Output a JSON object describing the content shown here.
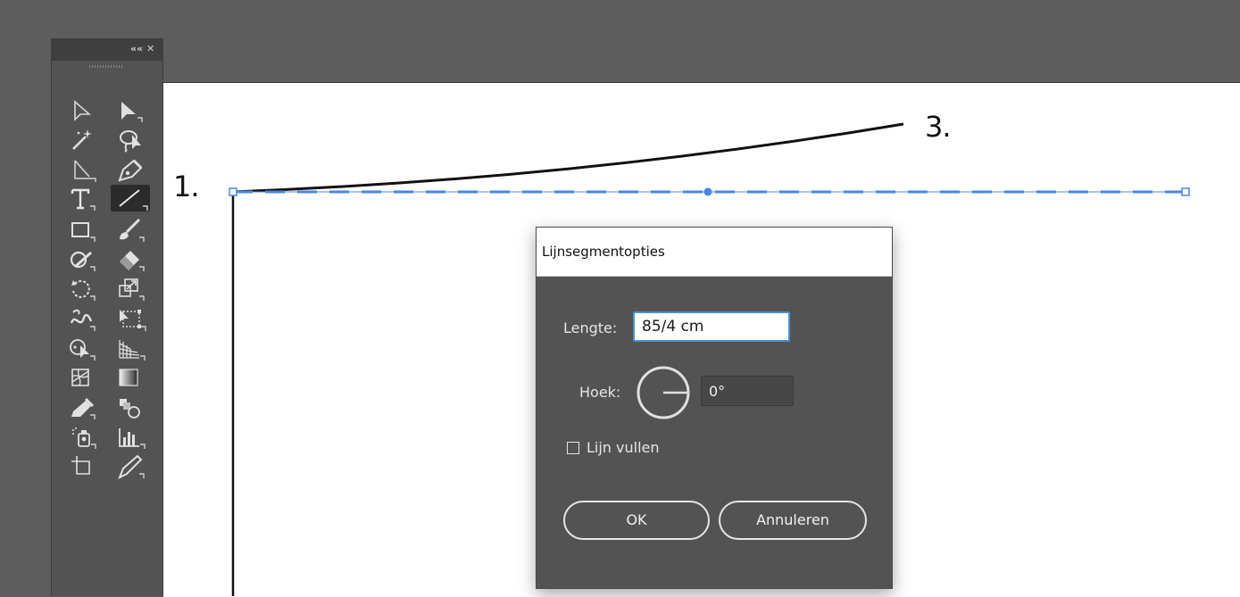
{
  "annotations": {
    "point1": "1.",
    "point3": "3."
  },
  "tools_panel": {
    "collapse_glyph": "««",
    "close_glyph": "✕",
    "tools": [
      {
        "name": "selection-tool",
        "icon": "selection-arrow-outline"
      },
      {
        "name": "direct-selection-tool",
        "icon": "direct-selection-arrow"
      },
      {
        "name": "magic-wand-tool",
        "icon": "magic-wand"
      },
      {
        "name": "lasso-tool",
        "icon": "lasso"
      },
      {
        "name": "anchor-direct-tool",
        "icon": "corner-arrow"
      },
      {
        "name": "pen-tool",
        "icon": "pen-nib"
      },
      {
        "name": "type-tool",
        "icon": "type-T"
      },
      {
        "name": "line-segment-tool",
        "icon": "line-segment",
        "active": true
      },
      {
        "name": "rectangle-tool",
        "icon": "rectangle"
      },
      {
        "name": "paintbrush-tool",
        "icon": "paintbrush"
      },
      {
        "name": "shaper-tool",
        "icon": "shaper"
      },
      {
        "name": "eraser-tool",
        "icon": "eraser"
      },
      {
        "name": "rotate-tool",
        "icon": "rotate"
      },
      {
        "name": "scale-tool",
        "icon": "scale"
      },
      {
        "name": "warp-tool",
        "icon": "warp"
      },
      {
        "name": "free-transform-tool",
        "icon": "free-transform"
      },
      {
        "name": "shape-builder-tool",
        "icon": "shape-builder"
      },
      {
        "name": "perspective-grid-tool",
        "icon": "perspective-grid"
      },
      {
        "name": "mesh-tool",
        "icon": "mesh"
      },
      {
        "name": "gradient-tool",
        "icon": "gradient"
      },
      {
        "name": "eyedropper-tool",
        "icon": "eyedropper"
      },
      {
        "name": "blend-tool",
        "icon": "blend"
      },
      {
        "name": "symbol-sprayer-tool",
        "icon": "symbol-sprayer"
      },
      {
        "name": "column-graph-tool",
        "icon": "column-graph"
      },
      {
        "name": "artboard-tool",
        "icon": "artboard"
      },
      {
        "name": "slice-tool",
        "icon": "slice-knife"
      }
    ]
  },
  "dialog": {
    "title": "Lijnsegmentopties",
    "length_label": "Lengte:",
    "length_value": "85/4 cm",
    "angle_label": "Hoek:",
    "angle_value": "0°",
    "fill_label": "Lijn vullen",
    "fill_checked": false,
    "ok_label": "OK",
    "cancel_label": "Annuleren"
  },
  "colors": {
    "selection_blue": "#4a86e8",
    "workspace": "#5d5d5d",
    "panel": "#535353"
  }
}
